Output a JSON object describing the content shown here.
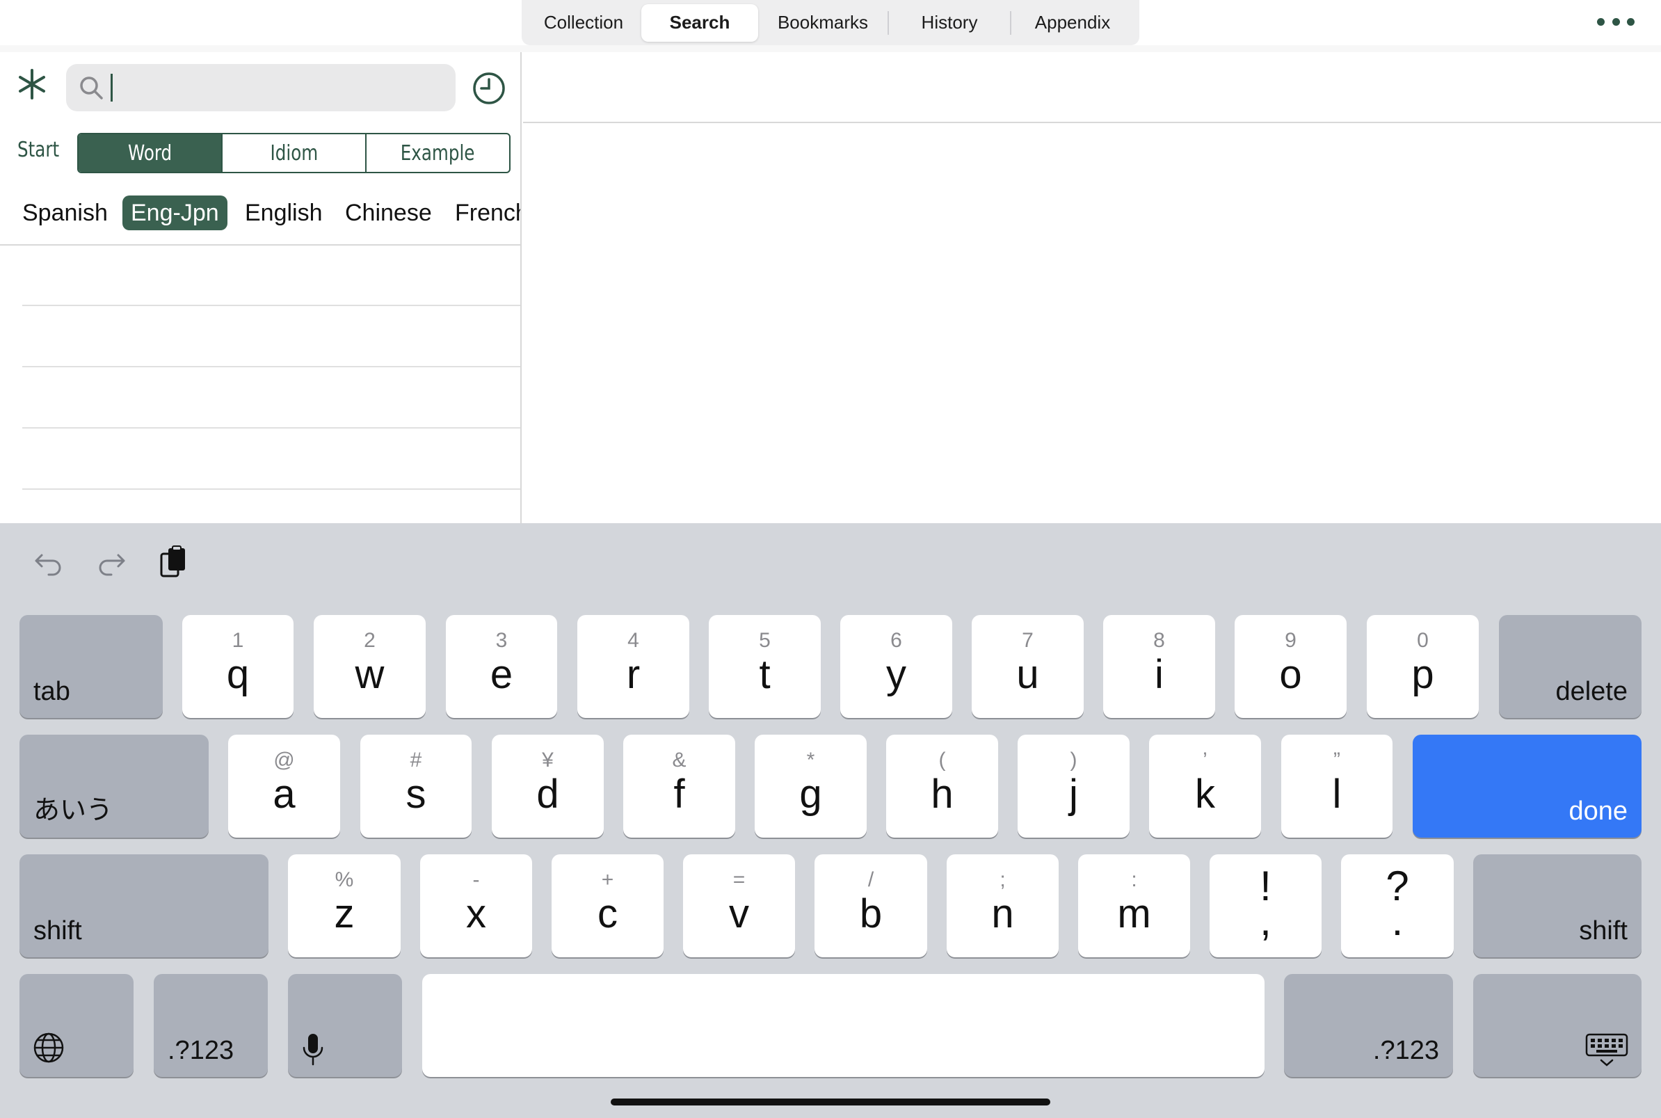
{
  "top_tabs": {
    "items": [
      "Collection",
      "Search",
      "Bookmarks",
      "History",
      "Appendix"
    ],
    "active_index": 1
  },
  "search": {
    "value": "",
    "placeholder": ""
  },
  "mode": {
    "start_label": "Start",
    "options": [
      "Word",
      "Idiom",
      "Example"
    ],
    "active_index": 0
  },
  "languages": {
    "items": [
      "Spanish",
      "Eng-Jpn",
      "English",
      "Chinese",
      "French"
    ],
    "active_index": 1
  },
  "keyboard": {
    "row1": [
      {
        "sub": "1",
        "main": "q"
      },
      {
        "sub": "2",
        "main": "w"
      },
      {
        "sub": "3",
        "main": "e"
      },
      {
        "sub": "4",
        "main": "r"
      },
      {
        "sub": "5",
        "main": "t"
      },
      {
        "sub": "6",
        "main": "y"
      },
      {
        "sub": "7",
        "main": "u"
      },
      {
        "sub": "8",
        "main": "i"
      },
      {
        "sub": "9",
        "main": "o"
      },
      {
        "sub": "0",
        "main": "p"
      }
    ],
    "row2": [
      {
        "sub": "@",
        "main": "a"
      },
      {
        "sub": "#",
        "main": "s"
      },
      {
        "sub": "¥",
        "main": "d"
      },
      {
        "sub": "&",
        "main": "f"
      },
      {
        "sub": "*",
        "main": "g"
      },
      {
        "sub": "(",
        "main": "h"
      },
      {
        "sub": ")",
        "main": "j"
      },
      {
        "sub": "’",
        "main": "k"
      },
      {
        "sub": "”",
        "main": "l"
      }
    ],
    "row3": [
      {
        "sub": "%",
        "main": "z"
      },
      {
        "sub": "-",
        "main": "x"
      },
      {
        "sub": "+",
        "main": "c"
      },
      {
        "sub": "=",
        "main": "v"
      },
      {
        "sub": "/",
        "main": "b"
      },
      {
        "sub": ";",
        "main": "n"
      },
      {
        "sub": ":",
        "main": "m"
      }
    ],
    "punct": [
      {
        "top": "!",
        "bottom": ","
      },
      {
        "top": "?",
        "bottom": "."
      }
    ],
    "tab_label": "tab",
    "delete_label": "delete",
    "kana_label": "あいう",
    "done_label": "done",
    "shift_label": "shift",
    "numbers_label": ".?123",
    "colors": {
      "accent": "#3a6150",
      "done": "#3478f6",
      "keyboard_bg": "#d3d6db",
      "dark_key": "#abb0ba"
    }
  }
}
